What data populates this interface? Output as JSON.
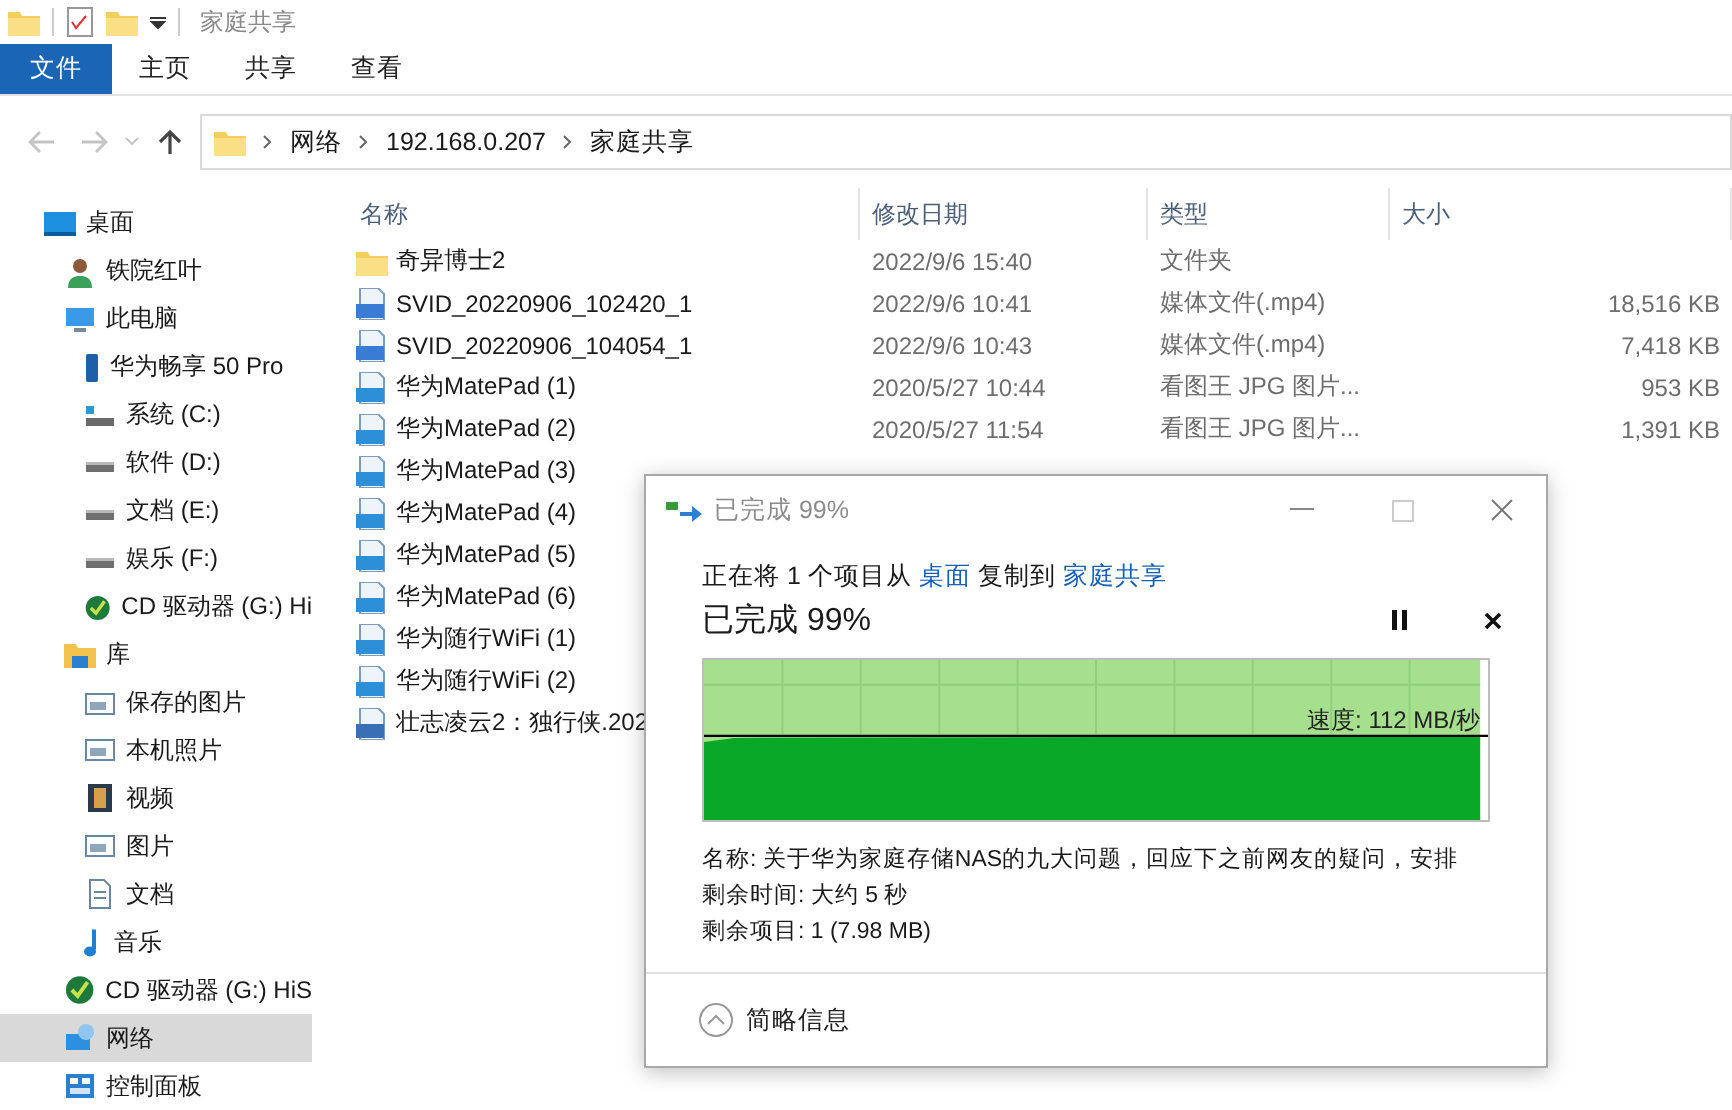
{
  "quick_access": {
    "title": "家庭共享"
  },
  "ribbon_tabs": [
    {
      "label": "文件",
      "selected": true
    },
    {
      "label": "主页",
      "selected": false
    },
    {
      "label": "共享",
      "selected": false
    },
    {
      "label": "查看",
      "selected": false
    }
  ],
  "address": {
    "crumbs": [
      "网络",
      "192.168.0.207",
      "家庭共享"
    ]
  },
  "sidebar": {
    "items": [
      {
        "label": "桌面",
        "kind": "desktop",
        "selected": false,
        "children": [
          {
            "label": "铁院红叶",
            "kind": "user",
            "selected": false
          },
          {
            "label": "此电脑",
            "kind": "pc",
            "selected": false,
            "children": [
              {
                "label": "华为畅享 50 Pro",
                "kind": "phone",
                "selected": false
              },
              {
                "label": "系统 (C:)",
                "kind": "system-drive",
                "selected": false
              },
              {
                "label": "软件 (D:)",
                "kind": "drive",
                "selected": false
              },
              {
                "label": "文档 (E:)",
                "kind": "drive",
                "selected": false
              },
              {
                "label": "娱乐 (F:)",
                "kind": "drive",
                "selected": false
              },
              {
                "label": "CD 驱动器 (G:) Hi",
                "kind": "cd",
                "selected": false
              }
            ]
          },
          {
            "label": "库",
            "kind": "library",
            "selected": false,
            "children": [
              {
                "label": "保存的图片",
                "kind": "pictures",
                "selected": false
              },
              {
                "label": "本机照片",
                "kind": "pictures",
                "selected": false
              },
              {
                "label": "视频",
                "kind": "video",
                "selected": false
              },
              {
                "label": "图片",
                "kind": "pictures",
                "selected": false
              },
              {
                "label": "文档",
                "kind": "document",
                "selected": false
              },
              {
                "label": "音乐",
                "kind": "music",
                "selected": false
              }
            ]
          },
          {
            "label": "CD 驱动器 (G:) HiS",
            "kind": "cd",
            "selected": false
          },
          {
            "label": "网络",
            "kind": "network",
            "selected": true
          },
          {
            "label": "控制面板",
            "kind": "control-panel",
            "selected": false
          }
        ]
      }
    ]
  },
  "file_list": {
    "columns": [
      "名称",
      "修改日期",
      "类型",
      "大小"
    ],
    "rows": [
      {
        "kind": "folder",
        "name": "奇异博士2",
        "date": "2022/9/6 15:40",
        "type": "文件夹"
      },
      {
        "kind": "video",
        "name": "SVID_20220906_102420_1",
        "date": "2022/9/6 10:41",
        "type": "媒体文件(.mp4)",
        "size": "18,516 KB"
      },
      {
        "kind": "video",
        "name": "SVID_20220906_104054_1",
        "date": "2022/9/6 10:43",
        "type": "媒体文件(.mp4)",
        "size": "7,418 KB"
      },
      {
        "kind": "image",
        "name": "华为MatePad (1)",
        "date": "2020/5/27 10:44",
        "type": "看图王 JPG 图片...",
        "size": "953 KB"
      },
      {
        "kind": "image",
        "name": "华为MatePad (2)",
        "date": "2020/5/27 11:54",
        "type": "看图王 JPG 图片...",
        "size": "1,391 KB"
      },
      {
        "kind": "image",
        "name": "华为MatePad (3)"
      },
      {
        "kind": "image",
        "name": "华为MatePad (4)"
      },
      {
        "kind": "image",
        "name": "华为MatePad (5)"
      },
      {
        "kind": "image",
        "name": "华为MatePad (6)"
      },
      {
        "kind": "image",
        "name": "华为随行WiFi (1)"
      },
      {
        "kind": "image",
        "name": "华为随行WiFi (2)"
      },
      {
        "kind": "movie",
        "name": "壮志凌云2：独行侠.202"
      }
    ]
  },
  "copy_dialog": {
    "title": "已完成 99%",
    "copy_line": {
      "prefix": "正在将 1 个项目从",
      "source": "桌面",
      "middle": "复制到",
      "target": "家庭共享"
    },
    "heading": "已完成 99%",
    "level": 0.99,
    "speed": "速度: 112 MB/秒",
    "details": [
      "名称: 关于华为家庭存储NAS的九大问题，回应下之前网友的疑问，安排",
      "剩余时间: 大约 5 秒",
      "剩余项目: 1 (7.98 MB)"
    ],
    "toggle": "简略信息"
  }
}
